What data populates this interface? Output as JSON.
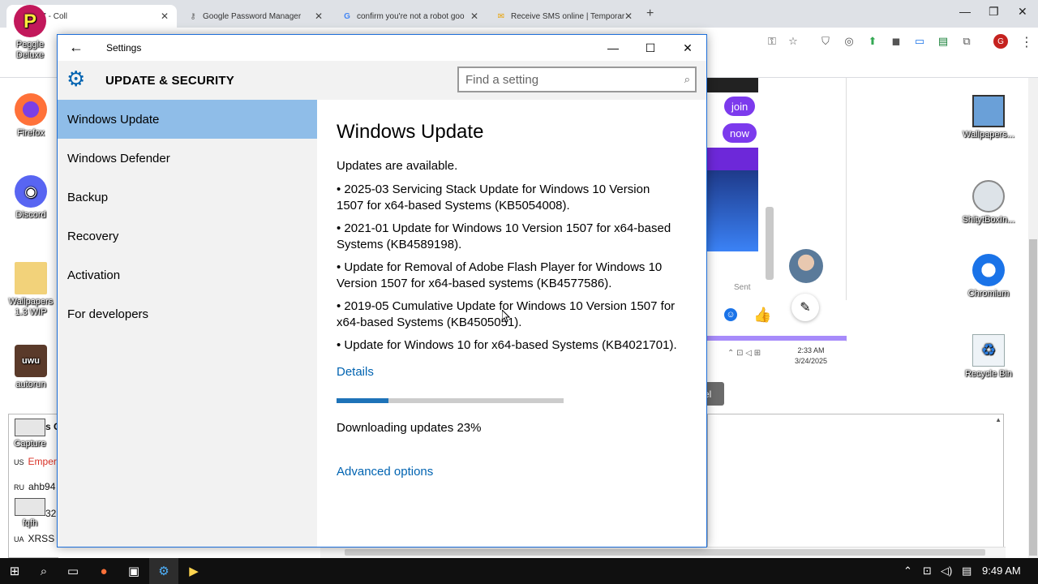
{
  "browser": {
    "tabs": [
      {
        "label": "vm7 - Coll",
        "favicon": "monitor-icon",
        "active": true
      },
      {
        "label": "Google Password Manager",
        "favicon": "key-icon",
        "active": false
      },
      {
        "label": "confirm you're not a robot goo",
        "favicon": "google-g-icon",
        "active": false
      },
      {
        "label": "Receive SMS online | Temporar",
        "favicon": "sms-icon",
        "active": false
      }
    ],
    "new_tab": "+",
    "profile_initial": "G"
  },
  "background_page": {
    "chips": [
      "join",
      "now"
    ],
    "sent_label": "Sent",
    "mini_clock_time": "2:33 AM",
    "mini_clock_date": "3/24/2025",
    "cancel_fragment": "el",
    "lang_rows": [
      {
        "code": "US",
        "text": "Emper"
      },
      {
        "code": "RU",
        "text": "ahb94"
      },
      {
        "code": "",
        "text": "32"
      },
      {
        "code": "UA",
        "text": "XRSS"
      }
    ],
    "truncated_s": "s C"
  },
  "desktop": {
    "icons_left": [
      "Peggle Deluxe",
      "Firefox",
      "Discord",
      "Wallpapers 1.3 WIP",
      "autorun",
      "Capture",
      "fqfh"
    ],
    "icons_right": [
      "Wallpapers...",
      "ShitytBoxIn...",
      "Chromium",
      "Recycle Bin"
    ]
  },
  "settings": {
    "window_title": "Settings",
    "header_title": "UPDATE & SECURITY",
    "search_placeholder": "Find a setting",
    "nav": [
      {
        "label": "Windows Update",
        "selected": true
      },
      {
        "label": "Windows Defender",
        "selected": false
      },
      {
        "label": "Backup",
        "selected": false
      },
      {
        "label": "Recovery",
        "selected": false
      },
      {
        "label": "Activation",
        "selected": false
      },
      {
        "label": "For developers",
        "selected": false
      }
    ],
    "content": {
      "title": "Windows Update",
      "status": "Updates are available.",
      "updates": [
        "• 2025-03 Servicing Stack Update for Windows 10 Version 1507 for x64-based Systems (KB5054008).",
        "• 2021-01 Update for Windows 10 Version 1507 for x64-based Systems (KB4589198).",
        "• Update for Removal of Adobe Flash Player for Windows 10 Version 1507 for x64-based systems (KB4577586).",
        "• 2019-05 Cumulative Update for Windows 10 Version 1507 for x64-based Systems (KB4505051).",
        "• Update for Windows 10 for x64-based Systems (KB4021701)."
      ],
      "details_link": "Details",
      "progress_percent": 23,
      "downloading_text": "Downloading updates 23%",
      "advanced_link": "Advanced options"
    }
  },
  "taskbar": {
    "time": "9:49 AM"
  },
  "colors": {
    "accent": "#0063b1",
    "selected_nav": "#8fbde8",
    "progress_fill": "#1e73b8"
  }
}
